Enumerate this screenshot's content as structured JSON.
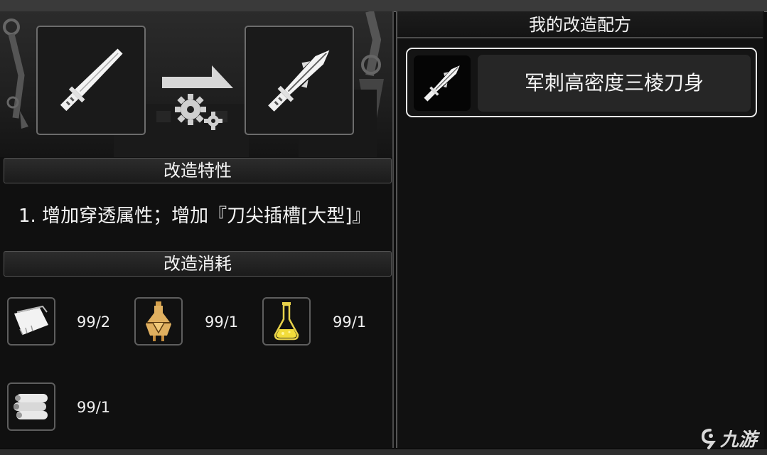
{
  "left": {
    "traits_header": "改造特性",
    "trait_text": "1. 增加穿透属性；增加『刀尖插槽[大型]』",
    "cost_header": "改造消耗",
    "materials": [
      {
        "icon": "paper-sheet-icon",
        "count": "99/2"
      },
      {
        "icon": "golden-lamp-flask-icon",
        "count": "99/1"
      },
      {
        "icon": "yellow-potion-flask-icon",
        "count": "99/1"
      },
      {
        "icon": "scroll-roll-icon",
        "count": "99/1"
      }
    ],
    "source_weapon_icon": "combat-blade-icon",
    "result_weapon_icon": "triangular-blade-icon"
  },
  "right": {
    "title": "我的改造配方",
    "recipes": [
      {
        "label": "军刺高密度三棱刀身",
        "icon": "triangular-blade-icon"
      }
    ]
  },
  "watermark": "九游"
}
